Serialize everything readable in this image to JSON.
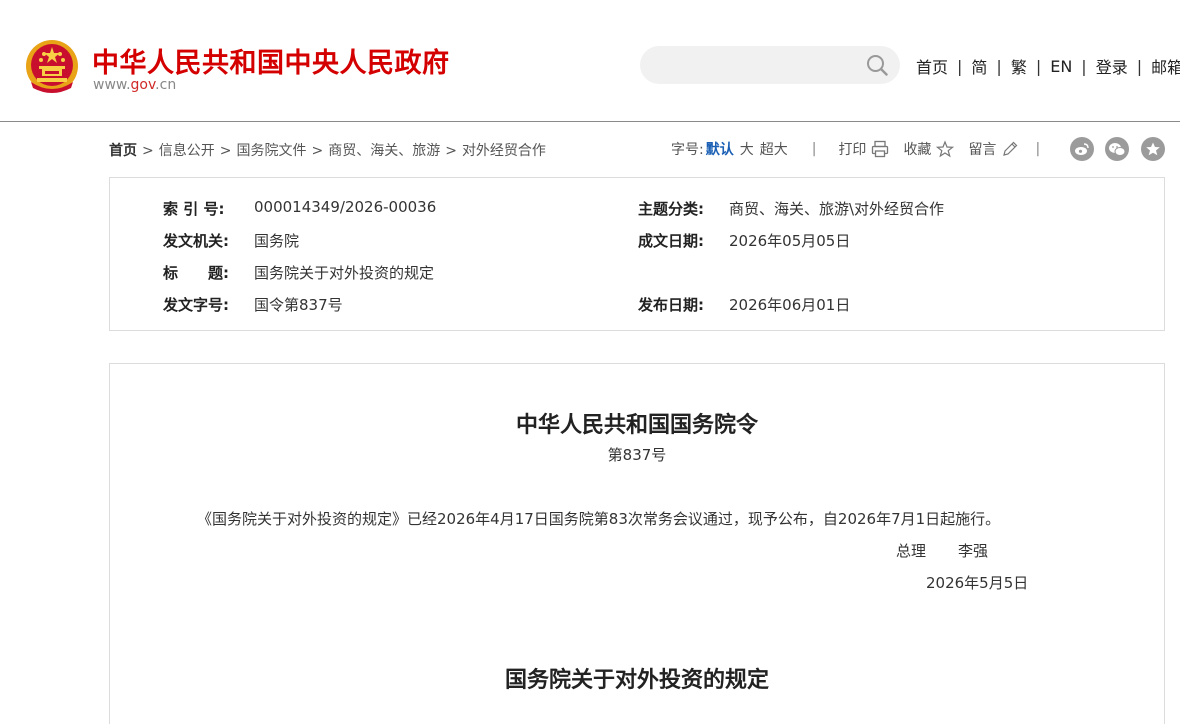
{
  "header": {
    "title": "中华人民共和国中央人民政府",
    "url_prefix": "www.",
    "url_gov": "gov",
    "url_suffix": ".cn",
    "search_placeholder": "",
    "nav": [
      "首页",
      "简",
      "繁",
      "EN",
      "登录",
      "邮箱"
    ],
    "nav_separator": "|",
    "brand_color": "#d40000"
  },
  "breadcrumb": {
    "items": [
      "首页",
      "信息公开",
      "国务院文件",
      "商贸、海关、旅游",
      "对外经贸合作"
    ],
    "separator": ">"
  },
  "tools": {
    "font_size_label": "字号:",
    "font_default": "默认",
    "font_large": "大",
    "font_xlarge": "超大",
    "separator": "|",
    "print": "打印",
    "favorite": "收藏",
    "comment": "留言",
    "share_icons": [
      "weibo-icon",
      "wechat-icon",
      "star-share-icon"
    ],
    "active_color": "#1a5fb4"
  },
  "info": {
    "index_label": "索 引 号:",
    "index_value": "000014349/2026-00036",
    "topic_label": "主题分类:",
    "topic_value": "商贸、海关、旅游\\对外经贸合作",
    "issuer_label": "发文机关:",
    "issuer_value": "国务院",
    "written_label": "成文日期:",
    "written_value": "2026年05月05日",
    "title_label": "标　　题:",
    "title_value": "国务院关于对外投资的规定",
    "docno_label": "发文字号:",
    "docno_value": "国令第837号",
    "published_label": "发布日期:",
    "published_value": "2026年06月01日"
  },
  "document": {
    "title": "中华人民共和国国务院令",
    "number": "第837号",
    "body": "《国务院关于对外投资的规定》已经2026年4月17日国务院第83次常务会议通过，现予公布，自2026年7月1日起施行。",
    "signer_title": "总理",
    "signer_name": "李强",
    "date": "2026年5月5日",
    "heading": "国务院关于对外投资的规定"
  }
}
